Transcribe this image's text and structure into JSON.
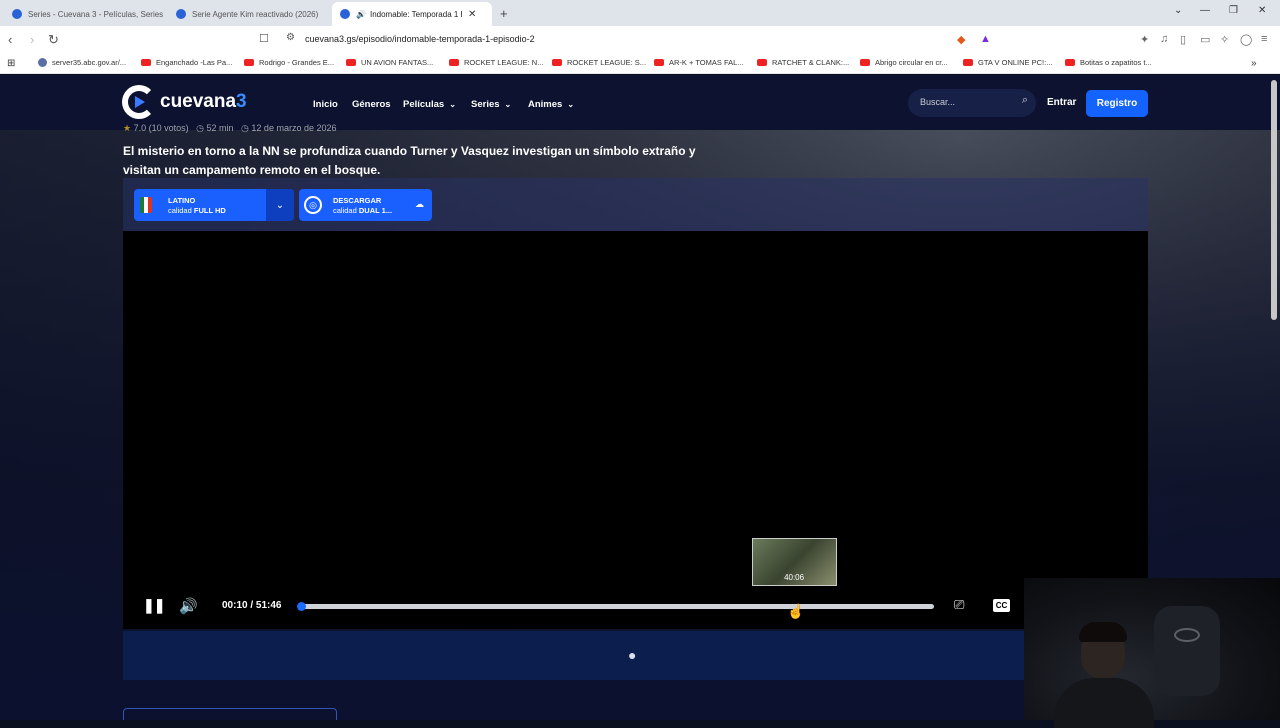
{
  "browser": {
    "tabs": [
      {
        "title": "Series - Cuevana 3 - Películas, Series"
      },
      {
        "title": "Serie Agente Kim reactivado (2026)"
      },
      {
        "title": "Indomable: Temporada 1 Ep"
      }
    ],
    "url": "cuevana3.gs/episodio/indomable-temporada-1-episodio-2",
    "bookmarks": [
      {
        "label": "server35.abc.gov.ar/..."
      },
      {
        "label": "Enganchado -Las Pa..."
      },
      {
        "label": "Rodrigo - Grandes E..."
      },
      {
        "label": "UN AVION FANTAS..."
      },
      {
        "label": "ROCKET LEAGUE: N..."
      },
      {
        "label": "ROCKET LEAGUE: S..."
      },
      {
        "label": "AR-K + TOMAS FAL..."
      },
      {
        "label": "RATCHET & CLANK:..."
      },
      {
        "label": "Abrigo circular en cr..."
      },
      {
        "label": "GTA V ONLINE PC!:..."
      },
      {
        "label": "Botitas o zapatitos t..."
      }
    ]
  },
  "site": {
    "logo": {
      "main": "cuevana",
      "suffix": "3"
    },
    "menu": [
      {
        "label": "Inicio",
        "chevron": false
      },
      {
        "label": "Géneros",
        "chevron": false
      },
      {
        "label": "Películas",
        "chevron": true
      },
      {
        "label": "Series",
        "chevron": true
      },
      {
        "label": "Animes",
        "chevron": true
      }
    ],
    "search_placeholder": "Buscar...",
    "login": "Entrar",
    "register": "Registro"
  },
  "episode": {
    "rating": "7.0 (10 votos)",
    "duration": "52 min",
    "date": "12 de marzo de 2026",
    "description": "El misterio en torno a la NN se profundiza cuando Turner y Vasquez investigan un símbolo extraño y visitan un campamento remoto en el bosque."
  },
  "language_button": {
    "language": "LATINO",
    "quality_prefix": "calidad",
    "quality": "FULL HD"
  },
  "download_button": {
    "label": "DESCARGAR",
    "quality_prefix": "calidad",
    "quality": "DUAL 1..."
  },
  "player": {
    "current_time": "00:10",
    "separator": "/",
    "total_time": "51:46",
    "progress_fraction": 0.003,
    "hover_fraction": 0.78,
    "preview_time": "40:06"
  },
  "colors": {
    "accent": "#1a5fff",
    "nav_bg": "#0c1230"
  }
}
